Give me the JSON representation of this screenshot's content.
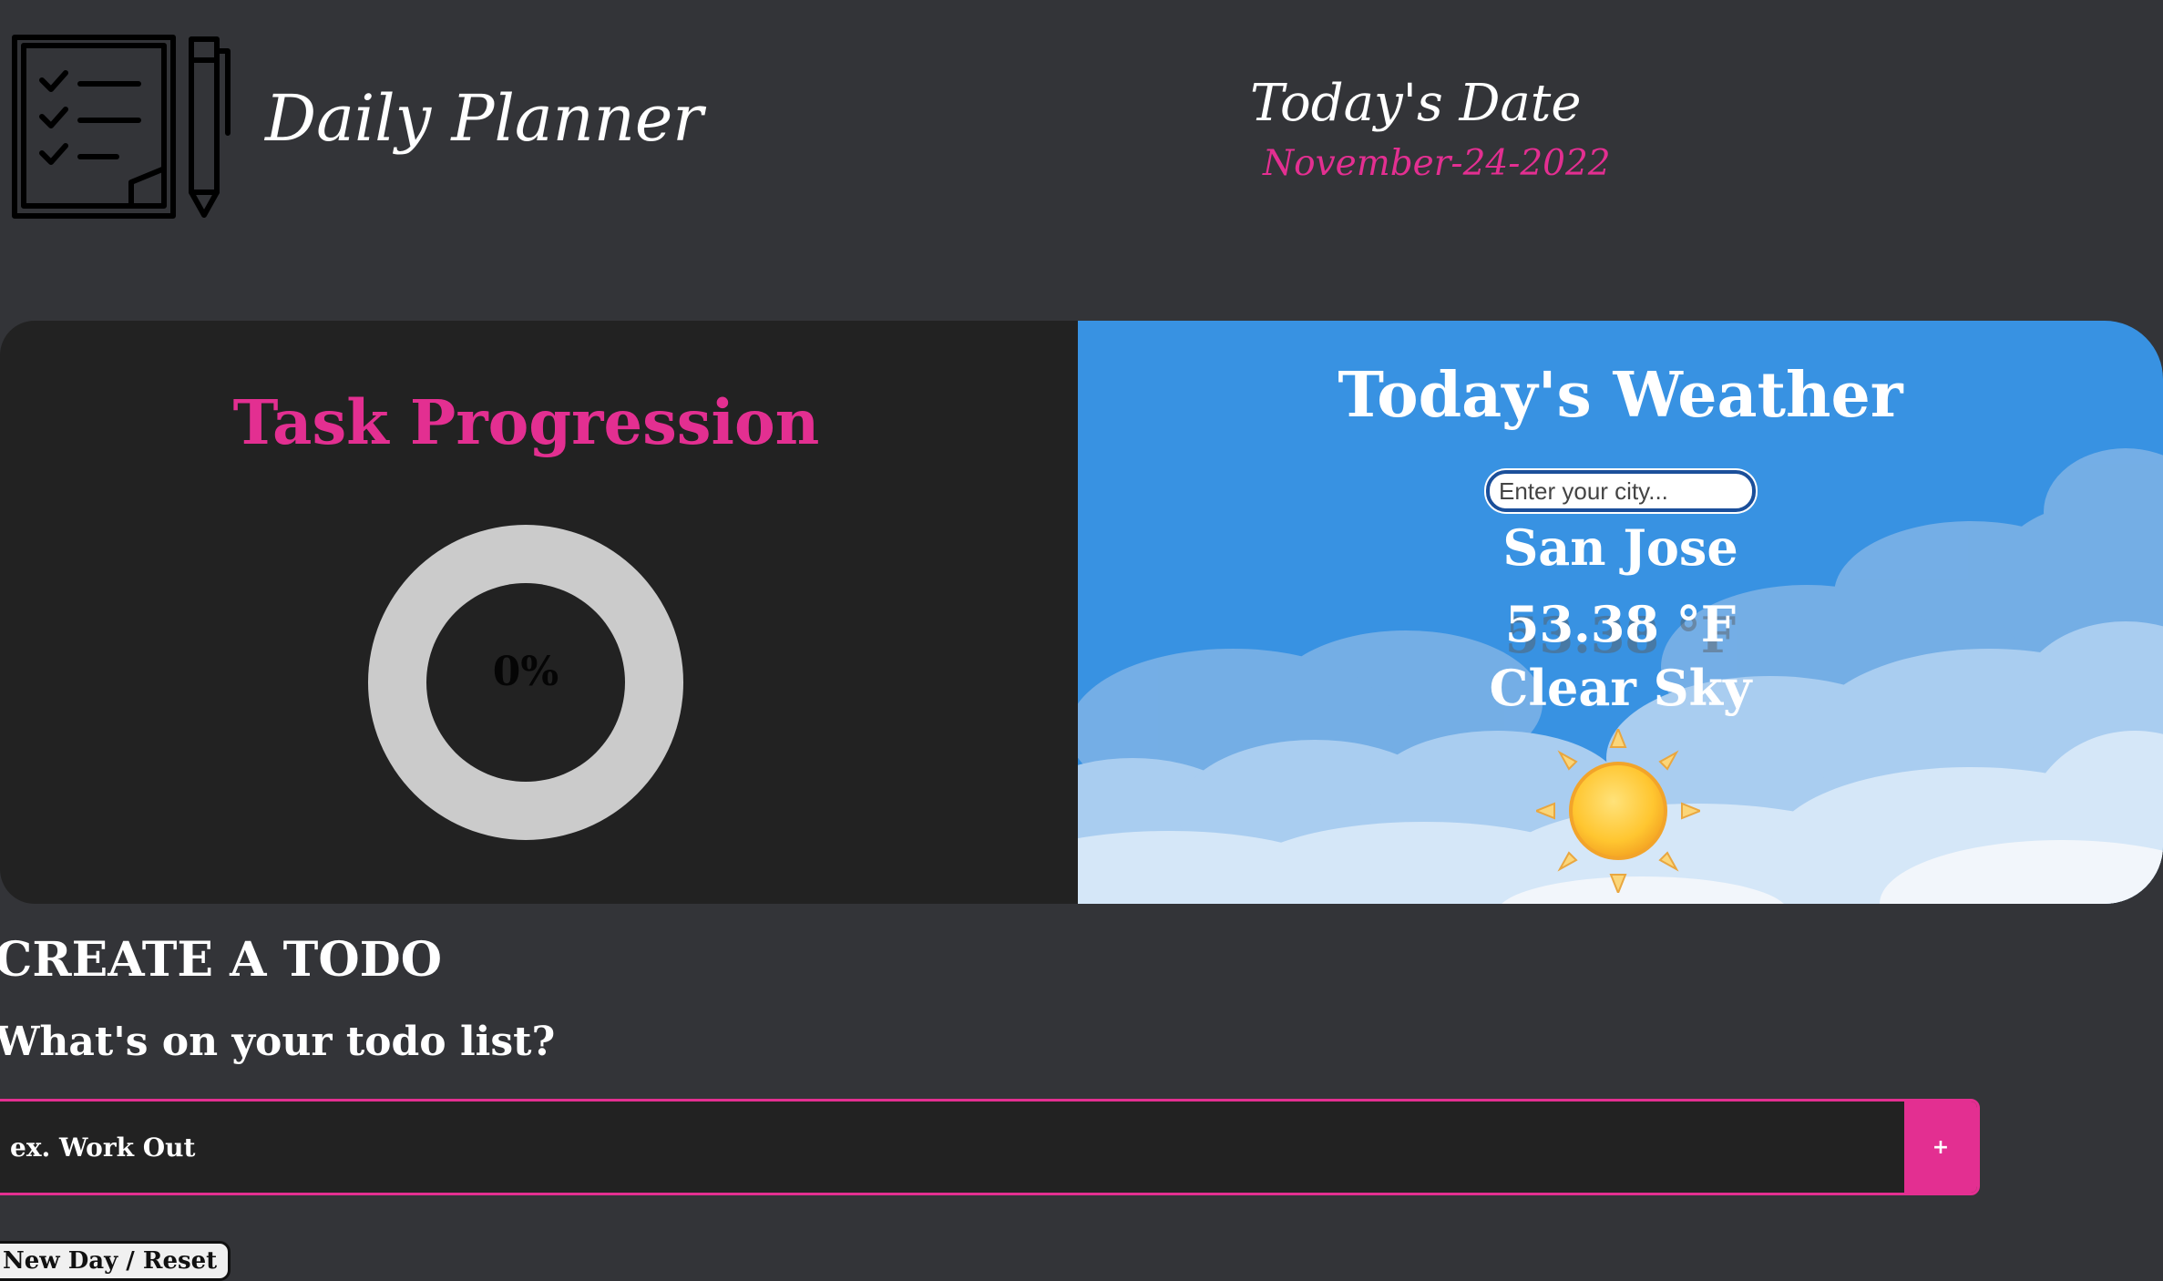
{
  "header": {
    "title": "Daily Planner",
    "logo_icon": "checklist-notepad-with-pen-icon",
    "date_label": "Today's Date",
    "date_value": "November-24-2022"
  },
  "progress": {
    "title": "Task Progression",
    "percent_label": "0%",
    "percent": 0
  },
  "weather": {
    "title": "Today's Weather",
    "city_placeholder": "Enter your city...",
    "city": "San Jose",
    "temperature": "53.38 °F",
    "description": "Clear Sky",
    "condition_icon": "sun-icon"
  },
  "todo": {
    "section_title": "CREATE A TODO",
    "prompt": "What's on your todo list?",
    "input_placeholder": "ex. Work Out",
    "add_label": "+",
    "reset_label": "New Day / Reset"
  },
  "colors": {
    "background": "#333438",
    "panel_dark": "#222222",
    "accent_pink": "#e32f91",
    "weather_blue": "#3892e2",
    "donut_ring": "#cbcbcb"
  }
}
